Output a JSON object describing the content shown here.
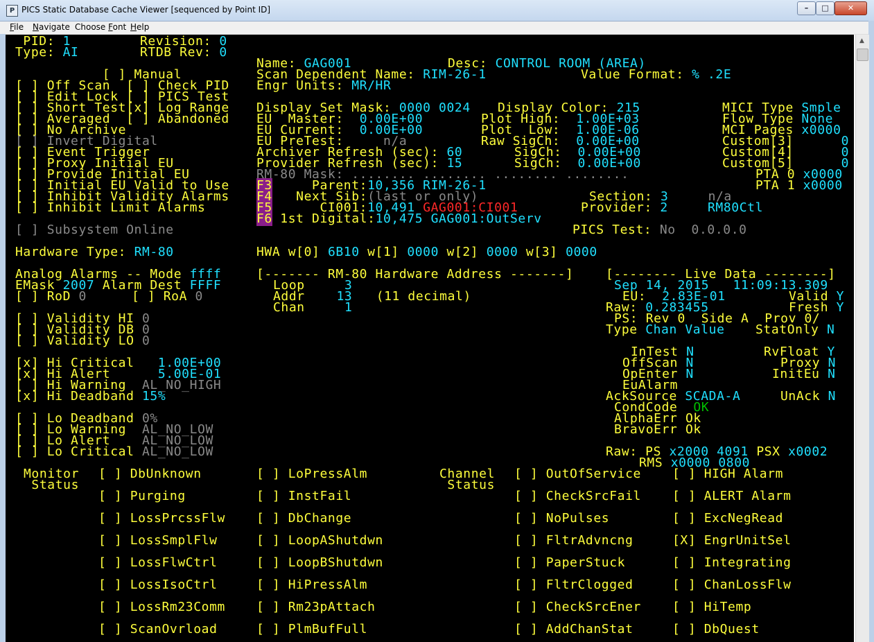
{
  "window": {
    "title": "PICS Static Database Cache Viewer [sequenced by Point ID]",
    "minimize_label": "–",
    "maximize_label": "□",
    "close_label": "✕"
  },
  "menu": {
    "file": {
      "u": "F",
      "rest": "ile"
    },
    "navigate": {
      "u": "N",
      "rest": "avigate"
    },
    "choose_font": {
      "pre": "Choose ",
      "u": "F",
      "rest": "ont"
    },
    "help": {
      "u": "H",
      "rest": "elp"
    }
  },
  "colors": {
    "yellow": "#ffff3c",
    "cyan": "#20e0ff",
    "gray": "#8a8a8a",
    "red": "#ff2828",
    "green": "#00c000",
    "fkey_bg": "#8a1e8a"
  },
  "icons": {
    "app": "pics-app-icon",
    "scroll_up": "scroll-up-arrow"
  },
  "header": {
    "pid_label": " PID:",
    "pid": "1",
    "revision_label": "Revision:",
    "revision": "0",
    "type_label": "Type:",
    "type": "AI",
    "rtdb_label": "RTDB Rev:",
    "rtdb": "0"
  },
  "point": {
    "name_label": "Name:",
    "name": "GAG001",
    "desc_label": "Desc:",
    "desc": "CONTROL ROOM (AREA)",
    "sdn_label": "Scan Dependent Name:",
    "sdn": "RIM-26-1",
    "vf_label": "Value Format:",
    "vf": "% .2E",
    "eu_label": "Engr Units:",
    "eu": "MR/HR",
    "dsm_label": "Display Set Mask:",
    "dsm": "0000 0024",
    "dc_label": "Display Color:",
    "dc": "215",
    "mici_label": "MICI Type",
    "mici": "Smple",
    "eum_label": "EU  Master:",
    "eum": "0.00E+00",
    "ph_label": "Plot High:",
    "ph": "1.00E+03",
    "ft_label": "Flow Type",
    "ft": "None",
    "euc_label": "EU Current:",
    "euc": "0.00E+00",
    "pl_label": "Plot  Low:",
    "pl": "1.00E-06",
    "mcip_label": "MCI Pages",
    "mcip": "x0000",
    "eup_label": "EU PreTest:",
    "eup": "n/a",
    "rsc_label": "Raw SigCh:",
    "rsc": "0.00E+00",
    "c3_label": "Custom[3]",
    "c3": "0",
    "arch_label": "Archiver Refresh (sec):",
    "arch": "60",
    "sc1_label": "SigCh:",
    "sc1": "0.00E+00",
    "c4_label": "Custom[4]",
    "c4": "0",
    "prov_label": "Provider Refresh (sec):",
    "prov": "15",
    "sc2_label": "SigCh:",
    "sc2": "0.00E+00",
    "c5_label": "Custom[5]",
    "c5": "0",
    "rm80_mask": "RM-80 Mask: ........ ........ ........ ........",
    "pta0_label": "PTA 0",
    "pta0": "x0000",
    "pta1_label": "PTA 1",
    "pta1": "x0000",
    "f3": "F3",
    "parent_label": "     Parent:",
    "parent": "10,356 RIM-26-1",
    "f4": "F4",
    "next_label": "   Next Sib:",
    "next": "(last or only)",
    "section_label": "Section:",
    "section": "3",
    "section_na": "n/a",
    "f5": "F5",
    "ci_label": "      CI001:",
    "ci_num": "10,491",
    "ci_name": "GAG001:CI001",
    "provider_label": "Provider:",
    "provider": "2",
    "provider_name": "RM80Ctl",
    "f6": "F6",
    "fd_label": " 1st Digital:",
    "fd": "10,475 GAG001:OutServ",
    "pics_test_label": "PICS Test:",
    "pics_test": "No  0.0.0.0"
  },
  "flags": [
    {
      "text": "           [ ] Manual",
      "gray": false
    },
    {
      "text": "[ ] Off Scan  [ ] Check PID",
      "gray": false
    },
    {
      "text": "[ ] Edit Lock [ ] PICS Test",
      "gray": false
    },
    {
      "text": "[ ] Short Test[x] Log Range",
      "gray": false
    },
    {
      "text": "[ ] Averaged  [ ] Abandoned",
      "gray": false
    },
    {
      "text": "[ ] No Archive",
      "gray": false
    },
    {
      "text": "[ ] Invert Digital",
      "gray": true
    },
    {
      "text": "[ ] Event Trigger",
      "gray": false
    },
    {
      "text": "[ ] Proxy Initial EU",
      "gray": false
    },
    {
      "text": "[ ] Provide Initial EU",
      "gray": false
    },
    {
      "text": "[ ] Initial EU Valid to Use",
      "gray": false
    },
    {
      "text": "[ ] Inhibit Validity Alarms",
      "gray": false
    },
    {
      "text": "[ ] Inhibit Limit Alarms",
      "gray": false
    }
  ],
  "subsystem": "[ ] Subsystem Online",
  "hardware": {
    "hw_label": "Hardware Type:",
    "hw": "RM-80",
    "hwa_label": "HWA w[0]",
    "w0": "6B10",
    "w1_label": "w[1]",
    "w1": "0000",
    "w2_label": "w[2]",
    "w2": "0000",
    "w3_label": "w[3]",
    "w3": "0000"
  },
  "alarms": {
    "mode_label": "Analog Alarms -- Mode",
    "mode": "ffff",
    "emask_label": "EMask",
    "emask": "2007",
    "dest_label": "Alarm Dest",
    "dest": "FFFF",
    "rod_label": "[ ] RoD",
    "rod": "0",
    "roa_label": "[ ] RoA",
    "roa": "0",
    "vhi_label": "[ ] Validity HI",
    "vhi": "0",
    "vdb_label": "[ ] Validity DB",
    "vdb": "0",
    "vlo_label": "[ ] Validity LO",
    "vlo": "0",
    "hic_label": "[x] Hi Critical",
    "hic": "1.00E+00",
    "hia_label": "[x] Hi Alert",
    "hia": "5.00E-01",
    "hiw_label": "[ ] Hi Warning",
    "hiw": "AL_NO_HIGH",
    "hid_label": "[x] Hi Deadband",
    "hid": "15%",
    "lod_label": "[ ] Lo Deadband",
    "lod": "0%",
    "low_label": "[ ] Lo Warning",
    "low": "AL_NO_LOW",
    "loa_label": "[ ] Lo Alert",
    "loa": "AL_NO_LOW",
    "loc_label": "[ ] Lo Critical",
    "loc": "AL_NO_LOW"
  },
  "hwaddr": {
    "title": "[------- RM-80 Hardware Address -------]",
    "loop_label": "Loop",
    "loop": "3",
    "addr_label": "Addr",
    "addr": "13",
    "addr_dec": "(11 decimal)",
    "chan_label": "Chan",
    "chan": "1"
  },
  "live": {
    "title": "[-------- Live Data --------]",
    "date": "Sep 14, 2015",
    "time": "11:09:13.309",
    "eu_label": "EU:",
    "eu": "2.83E-01",
    "valid_label": "Valid",
    "valid": "Y",
    "raw_label": "Raw:",
    "raw": "0.283455",
    "fresh_label": "Fresh",
    "fresh": "Y",
    "ps_label": "PS:",
    "ps": "Rev 0  Side A  Prov 0/",
    "type_label": "Type",
    "type": "Chan Value",
    "stat_label": "StatOnly",
    "stat": "N",
    "intest_label": "InTest",
    "intest": "N",
    "rvfloat_label": "RvFloat",
    "rvfloat": "Y",
    "offscan_label": "OffScan",
    "offscan": "N",
    "proxy_label": "Proxy",
    "proxy": "N",
    "openter_label": "OpEnter",
    "openter": "N",
    "initeu_label": "InitEu",
    "initeu": "N",
    "eualarm_label": "EuAlarm",
    "acksrc_label": "AckSource",
    "acksrc": "SCADA-A",
    "unack_label": "UnAck",
    "unack": "N",
    "cond_label": "CondCode",
    "cond": "OK",
    "alpha_label": "AlphaErr",
    "alpha": "Ok",
    "bravo_label": "BravoErr",
    "bravo": "Ok",
    "rawps_label": "Raw: PS",
    "rawps": "x2000 4091",
    "psx_label": "PSX",
    "psx": "x0002",
    "rms_label": "RMS",
    "rms": "x0000 0800"
  },
  "monitor": {
    "label1": "Monitor",
    "label2": " Status",
    "col1": [
      "[ ] DbUnknown",
      "[ ] Purging",
      "[ ] LossPrcssFlw",
      "[ ] LossSmplFlw",
      "[ ] LossFlwCtrl",
      "[ ] LossIsoCtrl",
      "[ ] LossRm23Comm",
      "[ ] ScanOvrload"
    ],
    "col2": [
      "[ ] LoPressAlm",
      "[ ] InstFail",
      "[ ] DbChange",
      "[ ] LoopAShutdwn",
      "[ ] LoopBShutdwn",
      "[ ] HiPressAlm",
      "[ ] Rm23pAttach",
      "[ ] PlmBufFull"
    ]
  },
  "channel": {
    "label1": "Channel",
    "label2": " Status",
    "col1": [
      "[ ] OutOfService",
      "[ ] CheckSrcFail",
      "[ ] NoPulses",
      "[ ] FltrAdvncng",
      "[ ] PaperStuck",
      "[ ] FltrClogged",
      "[ ] CheckSrcEner",
      "[ ] AddChanStat"
    ],
    "col2": [
      "[ ] HIGH Alarm",
      "[ ] ALERT Alarm",
      "[ ] ExcNegRead",
      "[X] EngrUnitSel",
      "[ ] Integrating",
      "[ ] ChanLossFlw",
      "[ ] HiTemp",
      "[ ] DbQuest"
    ]
  }
}
